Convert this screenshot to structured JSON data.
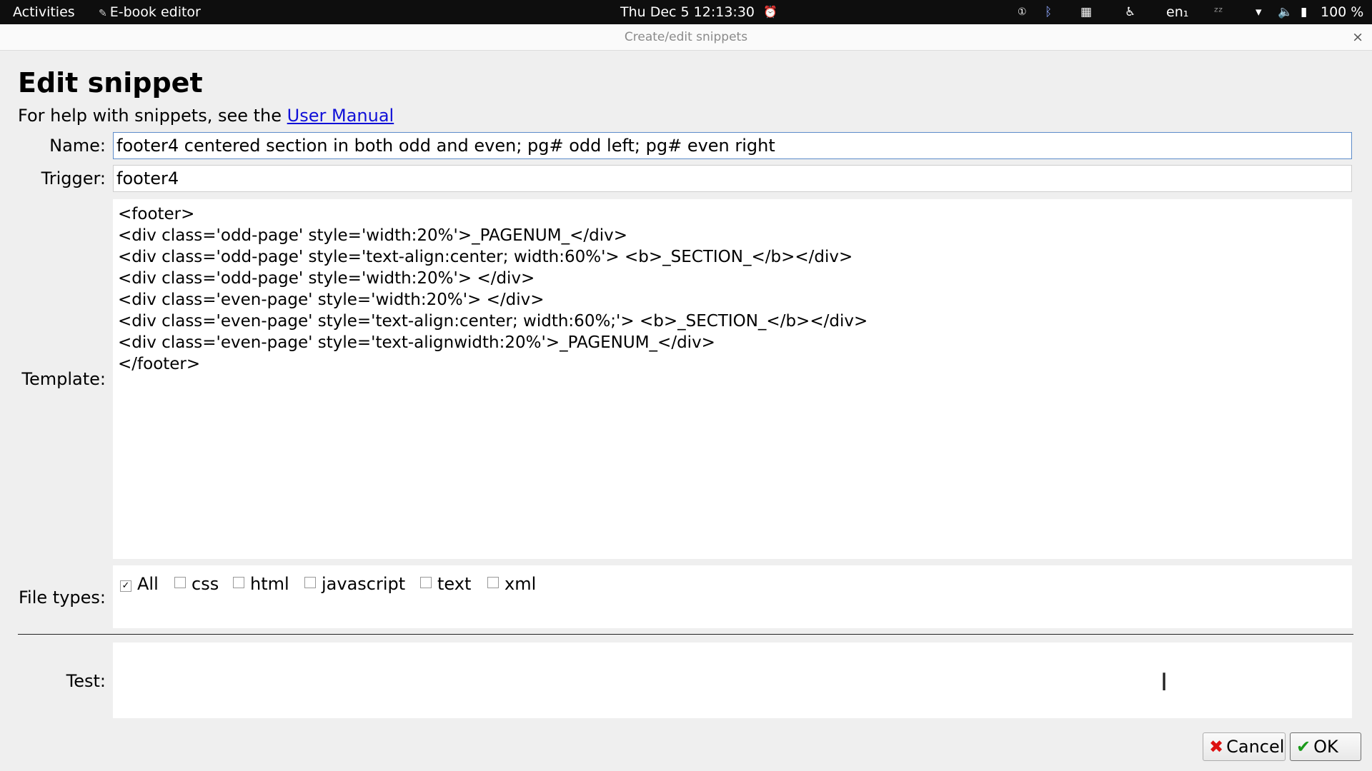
{
  "topbar": {
    "activities": "Activities",
    "app_name": "E-book editor",
    "clock": "Thu Dec 5  12:13:30",
    "language": "en₁",
    "battery": "100 %"
  },
  "dialog": {
    "title": "Create/edit snippets",
    "heading": "Edit snippet",
    "help_prefix": "For help with snippets, see the ",
    "help_link": "User Manual"
  },
  "form": {
    "name_label": "Name:",
    "name_value": "footer4 centered section in both odd and even; pg# odd left; pg# even right",
    "trigger_label": "Trigger:",
    "trigger_value": "footer4",
    "template_label": "Template:",
    "template_lines": [
      "<footer>",
      "<div class='odd-page' style='width:20%'>_PAGENUM_</div>",
      "<div class='odd-page' style='text-align:center; width:60%'> <b>_SECTION_</b></div>",
      "<div class='odd-page' style='width:20%'> </div>",
      "<div class='even-page' style='width:20%'> </div>",
      "<div class='even-page' style='text-align:center; width:60%;'> <b>_SECTION_</b></div>",
      "<div class='even-page' style='text-alignwidth:20%'>_PAGENUM_</div>",
      "</footer>"
    ],
    "filetypes_label": "File types:",
    "filetypes": [
      {
        "label": "All",
        "checked": true
      },
      {
        "label": "css",
        "checked": false
      },
      {
        "label": "html",
        "checked": false
      },
      {
        "label": "javascript",
        "checked": false
      },
      {
        "label": "text",
        "checked": false
      },
      {
        "label": "xml",
        "checked": false
      }
    ],
    "test_label": "Test:",
    "test_value": ""
  },
  "buttons": {
    "cancel": "Cancel",
    "ok": "OK"
  }
}
